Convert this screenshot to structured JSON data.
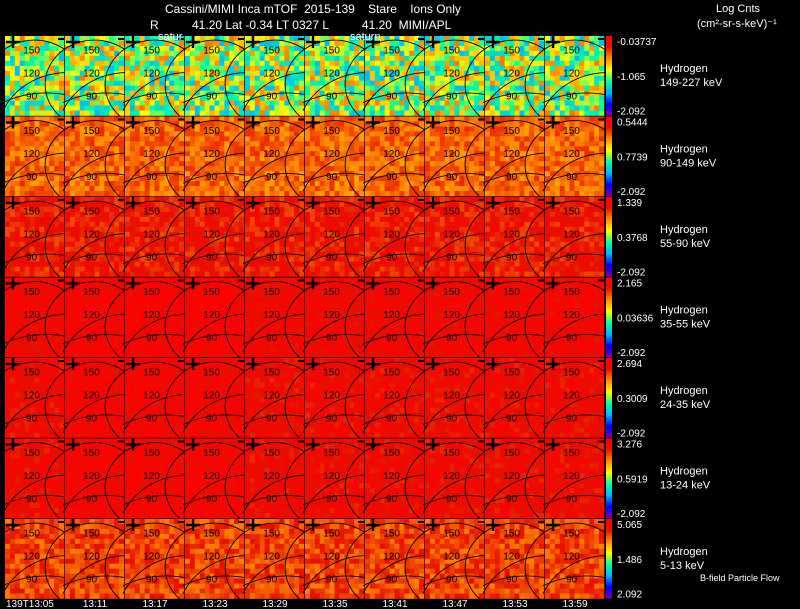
{
  "header": {
    "line1": "Cassini/MIMI Inca mTOF  2015-139    Stare    Ions Only",
    "line2": "R          41.20 Lat -0.34 LT 0327 L          41.20  MIMI/APL",
    "planet_label": "satur",
    "planet_label_2": "saturn"
  },
  "units": {
    "line1": "Log Cnts",
    "line2": "(cm²-sr-s-keV)⁻¹"
  },
  "contour_labels": [
    "150",
    "120",
    "90"
  ],
  "time_axis": {
    "labels": [
      "139T13:05",
      "13:11",
      "13:17",
      "13:23",
      "13:29",
      "13:35",
      "13:41",
      "13:47",
      "13:53",
      "13:59"
    ]
  },
  "footer_label": "B-field Particle Flow",
  "colors": {
    "background": "#000000",
    "text": "#ffffff",
    "contour": "#000000",
    "colorbar": [
      "#7a00a8",
      "#0000ff",
      "#00b4ff",
      "#00ffa0",
      "#ffff00",
      "#ff9000",
      "#e81000",
      "#ff0000"
    ]
  },
  "chart_data": {
    "type": "heatmap",
    "description_rows": "7 energy channels x 10 time frames, each frame an INCA image of hydrogen intensity",
    "rows": [
      {
        "species": "Hydrogen",
        "energy": "149-227 keV",
        "scale_max": "-0.03737",
        "scale_mid": "-1.065",
        "scale_min": "-2.092",
        "level": 0.52
      },
      {
        "species": "Hydrogen",
        "energy": "90-149 keV",
        "scale_max": "0.5444",
        "scale_mid": "0.7739",
        "scale_min": "-2.092",
        "level": 0.76
      },
      {
        "species": "Hydrogen",
        "energy": "55-90 keV",
        "scale_max": "1.339",
        "scale_mid": "0.3768",
        "scale_min": "-2.092",
        "level": 0.86
      },
      {
        "species": "Hydrogen",
        "energy": "35-55 keV",
        "scale_max": "2.165",
        "scale_mid": "0.03636",
        "scale_min": "-2.092",
        "level": 0.92
      },
      {
        "species": "Hydrogen",
        "energy": "24-35 keV",
        "scale_max": "2.694",
        "scale_mid": "0.3009",
        "scale_min": "-2.092",
        "level": 0.9
      },
      {
        "species": "Hydrogen",
        "energy": "13-24 keV",
        "scale_max": "3.276",
        "scale_mid": "0.5919",
        "scale_min": "-2.092",
        "level": 0.9
      },
      {
        "species": "Hydrogen",
        "energy": "5-13 keV",
        "scale_max": "5.065",
        "scale_mid": "1.486",
        "scale_min": "2.092",
        "level": 0.8
      }
    ],
    "frames": [
      "139T13:05",
      "13:11",
      "13:17",
      "13:23",
      "13:29",
      "13:35",
      "13:41",
      "13:47",
      "13:53",
      "13:59"
    ],
    "contours": [
      150,
      120,
      90
    ]
  }
}
